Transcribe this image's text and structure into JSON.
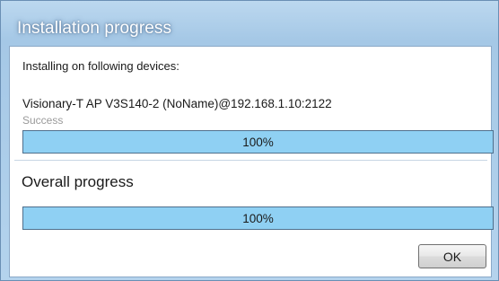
{
  "window": {
    "title": "Installation progress"
  },
  "devices_label": "Installing on following devices:",
  "device": {
    "name": "Visionary-T AP V3S140-2 (NoName)@192.168.1.10:2122",
    "status": "Success",
    "progress_text": "100%",
    "progress_fraction": 1.0
  },
  "overall": {
    "label": "Overall progress",
    "progress_text": "100%",
    "progress_fraction": 1.0
  },
  "buttons": {
    "ok_label": "OK"
  },
  "colors": {
    "titlebar": "#a5c8e6",
    "progress_fill": "#8fd0f3",
    "progress_border": "#4f6f8c",
    "status_text": "#9a9a9a"
  }
}
